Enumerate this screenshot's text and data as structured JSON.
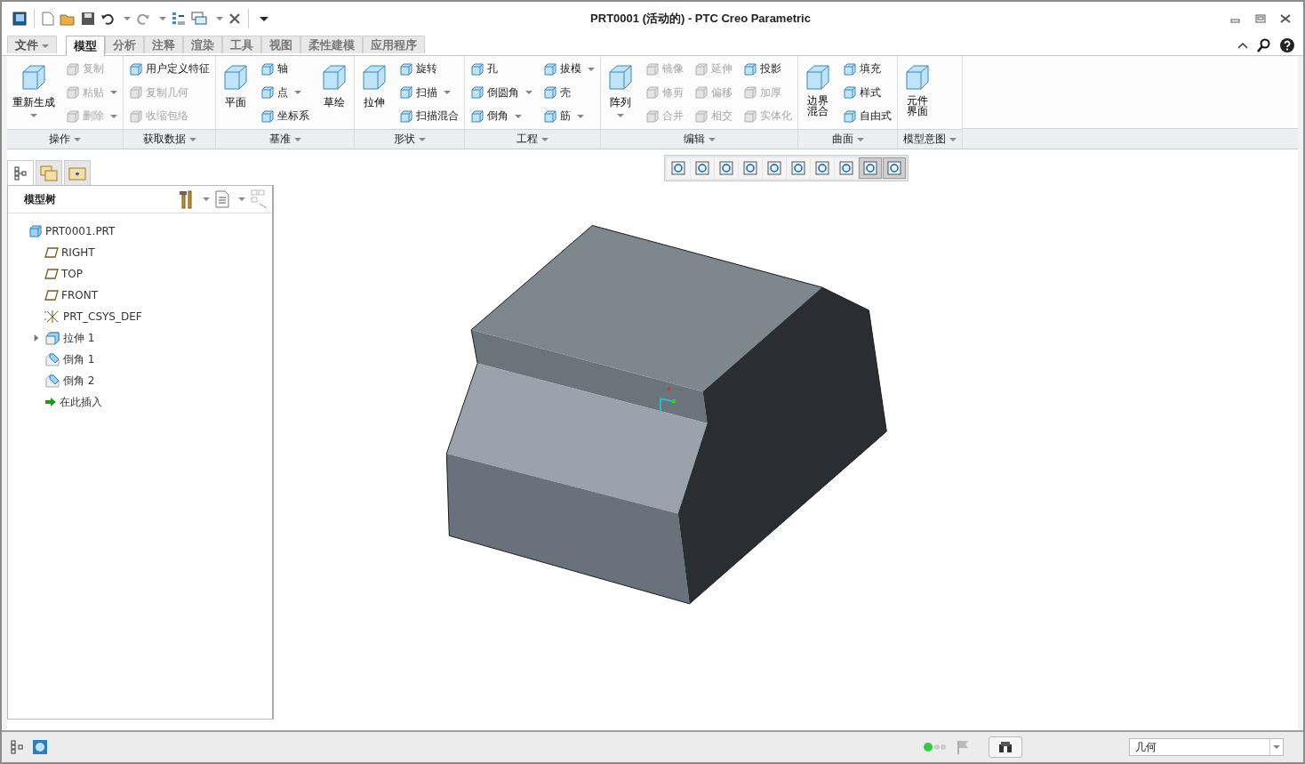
{
  "window": {
    "title": "PRT0001 (活动的) - PTC Creo Parametric"
  },
  "tabs": [
    {
      "label": "文件",
      "kind": "menu",
      "selected": false
    },
    {
      "label": "模型",
      "kind": "tab",
      "selected": true
    },
    {
      "label": "分析",
      "kind": "tab",
      "selected": false
    },
    {
      "label": "注释",
      "kind": "tab",
      "selected": false
    },
    {
      "label": "渲染",
      "kind": "tab",
      "selected": false
    },
    {
      "label": "工具",
      "kind": "tab",
      "selected": false
    },
    {
      "label": "视图",
      "kind": "tab",
      "selected": false
    },
    {
      "label": "柔性建模",
      "kind": "tab",
      "selected": false
    },
    {
      "label": "应用程序",
      "kind": "tab",
      "selected": false
    }
  ],
  "ribbon": {
    "groups": [
      {
        "label": "操作",
        "columns": [
          [
            {
              "label": "重新生成",
              "kind": "large",
              "dropdown": true,
              "disabled": false
            }
          ],
          [
            {
              "label": "复制",
              "kind": "small",
              "dropdown": false,
              "disabled": true
            },
            {
              "label": "粘贴",
              "kind": "small",
              "dropdown": true,
              "disabled": true
            },
            {
              "label": "删除",
              "kind": "small",
              "dropdown": true,
              "disabled": true
            }
          ]
        ]
      },
      {
        "label": "获取数据",
        "columns": [
          [
            {
              "label": "用户定义特征",
              "kind": "small",
              "dropdown": false,
              "disabled": false
            },
            {
              "label": "复制几何",
              "kind": "small",
              "dropdown": false,
              "disabled": true
            },
            {
              "label": "收缩包络",
              "kind": "small",
              "dropdown": false,
              "disabled": true
            }
          ]
        ]
      },
      {
        "label": "基准",
        "columns": [
          [
            {
              "label": "平面",
              "kind": "large",
              "dropdown": false,
              "disabled": false
            }
          ],
          [
            {
              "label": "轴",
              "kind": "small",
              "dropdown": false,
              "disabled": false
            },
            {
              "label": "点",
              "kind": "small",
              "dropdown": true,
              "disabled": false
            },
            {
              "label": "坐标系",
              "kind": "small",
              "dropdown": false,
              "disabled": false
            }
          ],
          [
            {
              "label": "草绘",
              "kind": "large",
              "dropdown": false,
              "disabled": false
            }
          ]
        ]
      },
      {
        "label": "形状",
        "columns": [
          [
            {
              "label": "拉伸",
              "kind": "large",
              "dropdown": false,
              "disabled": false
            }
          ],
          [
            {
              "label": "旋转",
              "kind": "small",
              "dropdown": false,
              "disabled": false
            },
            {
              "label": "扫描",
              "kind": "small",
              "dropdown": true,
              "disabled": false
            },
            {
              "label": "扫描混合",
              "kind": "small",
              "dropdown": false,
              "disabled": false
            }
          ]
        ]
      },
      {
        "label": "工程",
        "columns": [
          [
            {
              "label": "孔",
              "kind": "small",
              "dropdown": false,
              "disabled": false
            },
            {
              "label": "倒圆角",
              "kind": "small",
              "dropdown": true,
              "disabled": false
            },
            {
              "label": "倒角",
              "kind": "small",
              "dropdown": true,
              "disabled": false
            }
          ],
          [
            {
              "label": "拔模",
              "kind": "small",
              "dropdown": true,
              "disabled": false
            },
            {
              "label": "壳",
              "kind": "small",
              "dropdown": false,
              "disabled": false
            },
            {
              "label": "筋",
              "kind": "small",
              "dropdown": true,
              "disabled": false
            }
          ]
        ]
      },
      {
        "label": "编辑",
        "columns": [
          [
            {
              "label": "阵列",
              "kind": "large",
              "dropdown": true,
              "disabled": false
            }
          ],
          [
            {
              "label": "镜像",
              "kind": "small",
              "dropdown": false,
              "disabled": true
            },
            {
              "label": "修剪",
              "kind": "small",
              "dropdown": false,
              "disabled": true
            },
            {
              "label": "合并",
              "kind": "small",
              "dropdown": false,
              "disabled": true
            }
          ],
          [
            {
              "label": "延伸",
              "kind": "small",
              "dropdown": false,
              "disabled": true
            },
            {
              "label": "偏移",
              "kind": "small",
              "dropdown": false,
              "disabled": true
            },
            {
              "label": "相交",
              "kind": "small",
              "dropdown": false,
              "disabled": true
            }
          ],
          [
            {
              "label": "投影",
              "kind": "small",
              "dropdown": false,
              "disabled": false
            },
            {
              "label": "加厚",
              "kind": "small",
              "dropdown": false,
              "disabled": true
            },
            {
              "label": "实体化",
              "kind": "small",
              "dropdown": false,
              "disabled": true
            }
          ]
        ]
      },
      {
        "label": "曲面",
        "columns": [
          [
            {
              "label": "边界混合",
              "kind": "stacked",
              "dropdown": false,
              "disabled": false
            }
          ],
          [
            {
              "label": "填充",
              "kind": "small",
              "dropdown": false,
              "disabled": false
            },
            {
              "label": "样式",
              "kind": "small",
              "dropdown": false,
              "disabled": false
            },
            {
              "label": "自由式",
              "kind": "small",
              "dropdown": false,
              "disabled": false
            }
          ]
        ]
      },
      {
        "label": "模型意图",
        "columns": [
          [
            {
              "label": "元件界面",
              "kind": "stacked",
              "dropdown": false,
              "disabled": false
            }
          ]
        ]
      }
    ]
  },
  "tree_tabs": [
    {
      "selected": true
    },
    {
      "selected": false
    },
    {
      "selected": false
    }
  ],
  "tree": {
    "title": "模型树",
    "items": [
      {
        "label": "PRT0001.PRT",
        "kind": "part",
        "children": [
          {
            "label": "RIGHT",
            "kind": "plane"
          },
          {
            "label": "TOP",
            "kind": "plane"
          },
          {
            "label": "FRONT",
            "kind": "plane"
          },
          {
            "label": "PRT_CSYS_DEF",
            "kind": "csys"
          },
          {
            "label": "拉伸 1",
            "kind": "extrude",
            "expanded": false
          },
          {
            "label": "倒角 1",
            "kind": "chamfer"
          },
          {
            "label": "倒角 2",
            "kind": "chamfer"
          },
          {
            "label": "在此插入",
            "kind": "insert"
          }
        ]
      }
    ]
  },
  "view_toolbar": [
    {
      "pressed": false
    },
    {
      "pressed": false
    },
    {
      "pressed": false
    },
    {
      "pressed": false
    },
    {
      "pressed": false
    },
    {
      "pressed": false
    },
    {
      "pressed": false
    },
    {
      "pressed": false
    },
    {
      "pressed": true
    },
    {
      "pressed": true
    }
  ],
  "status_bar": {
    "filter": {
      "value": "几何"
    }
  }
}
